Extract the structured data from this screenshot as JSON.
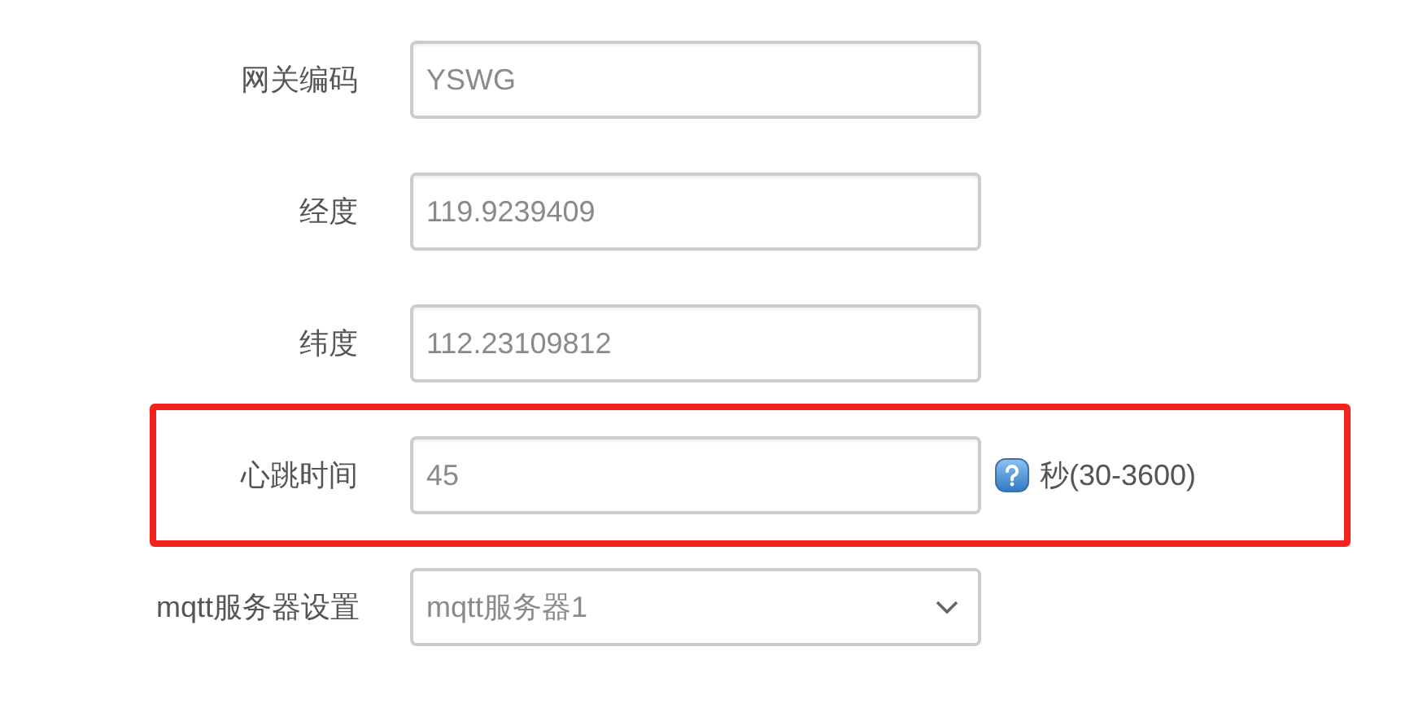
{
  "form": {
    "rows": [
      {
        "label": "网关编码",
        "field": {
          "kind": "text",
          "value": "YSWG"
        },
        "highlighted": false
      },
      {
        "label": "经度",
        "field": {
          "kind": "text",
          "value": "119.9239409"
        },
        "highlighted": false
      },
      {
        "label": "纬度",
        "field": {
          "kind": "text",
          "value": "112.23109812"
        },
        "highlighted": false
      },
      {
        "label": "心跳时间",
        "field": {
          "kind": "text",
          "value": "45"
        },
        "hint": "秒(30-3600)",
        "highlighted": true
      },
      {
        "label": "mqtt服务器设置",
        "field": {
          "kind": "select",
          "value": "mqtt服务器1"
        },
        "highlighted": false
      }
    ]
  }
}
